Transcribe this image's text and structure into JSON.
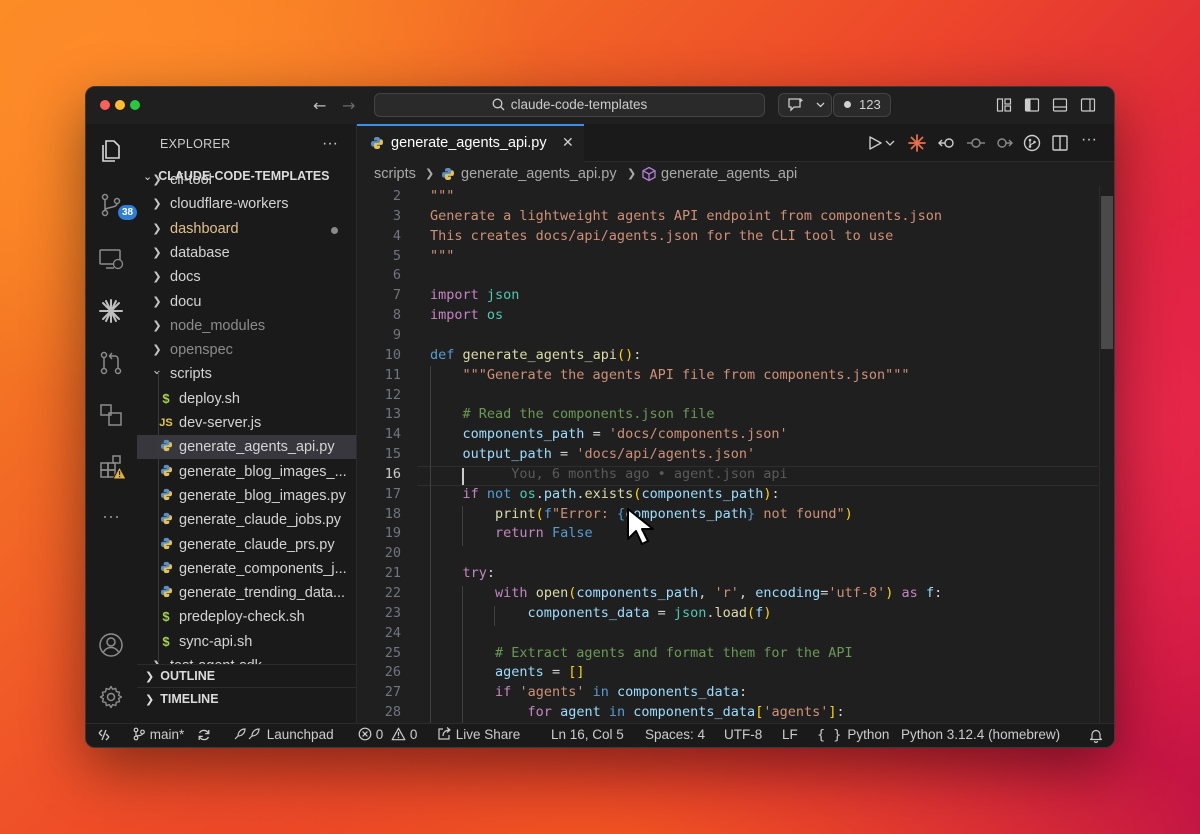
{
  "titlebar": {
    "search_text": "claude-code-templates",
    "count": "123"
  },
  "activity": {
    "scm_badge": "38"
  },
  "sidebar": {
    "header": "EXPLORER",
    "more": "···",
    "root": "CLAUDE-CODE-TEMPLATES",
    "items": [
      {
        "label": "cli-tool",
        "type": "folder"
      },
      {
        "label": "cloudflare-workers",
        "type": "folder"
      },
      {
        "label": "dashboard",
        "type": "folder"
      },
      {
        "label": "database",
        "type": "folder"
      },
      {
        "label": "docs",
        "type": "folder"
      },
      {
        "label": "docu",
        "type": "folder"
      },
      {
        "label": "node_modules",
        "type": "folder"
      },
      {
        "label": "openspec",
        "type": "folder"
      },
      {
        "label": "scripts",
        "type": "folder-open"
      },
      {
        "label": "deploy.sh",
        "type": "sh"
      },
      {
        "label": "dev-server.js",
        "type": "js"
      },
      {
        "label": "generate_agents_api.py",
        "type": "py"
      },
      {
        "label": "generate_blog_images_...",
        "type": "py"
      },
      {
        "label": "generate_blog_images.py",
        "type": "py"
      },
      {
        "label": "generate_claude_jobs.py",
        "type": "py"
      },
      {
        "label": "generate_claude_prs.py",
        "type": "py"
      },
      {
        "label": "generate_components_j...",
        "type": "py"
      },
      {
        "label": "generate_trending_data...",
        "type": "py"
      },
      {
        "label": "predeploy-check.sh",
        "type": "sh"
      },
      {
        "label": "sync-api.sh",
        "type": "sh"
      },
      {
        "label": "test-agent-sdk",
        "type": "folder"
      }
    ],
    "outline": "OUTLINE",
    "timeline": "TIMELINE"
  },
  "editor": {
    "tab_label": "generate_agents_api.py",
    "breadcrumb": [
      "scripts",
      "generate_agents_api.py",
      "generate_agents_api"
    ],
    "lines": [
      {
        "n": "2",
        "html": "<span class=\"tok-str\">\"\"\"</span>"
      },
      {
        "n": "3",
        "html": "<span class=\"tok-str\">Generate a lightweight agents API endpoint from components.json</span>"
      },
      {
        "n": "4",
        "html": "<span class=\"tok-str\">This creates docs/api/agents.json for the CLI tool to use</span>"
      },
      {
        "n": "5",
        "html": "<span class=\"tok-str\">\"\"\"</span>"
      },
      {
        "n": "6",
        "html": ""
      },
      {
        "n": "7",
        "html": "<span class=\"tok-ctl\">import</span> <span class=\"tok-bi\">json</span>"
      },
      {
        "n": "8",
        "html": "<span class=\"tok-ctl\">import</span> <span class=\"tok-bi\">os</span>"
      },
      {
        "n": "9",
        "html": ""
      },
      {
        "n": "10",
        "html": "<span class=\"tok-kw\">def</span> <span class=\"tok-fn\">generate_agents_api</span><span class=\"tok-br1\">()</span>:"
      },
      {
        "n": "11",
        "html": "    <span class=\"tok-str\">\"\"\"Generate the agents API file from components.json\"\"\"</span>"
      },
      {
        "n": "12",
        "html": ""
      },
      {
        "n": "13",
        "html": "    <span class=\"tok-cm\"># Read the components.json file</span>"
      },
      {
        "n": "14",
        "html": "    <span class=\"tok-var\">components_path</span> = <span class=\"tok-str\">'docs/components.json'</span>"
      },
      {
        "n": "15",
        "html": "    <span class=\"tok-var\">output_path</span> = <span class=\"tok-str\">'docs/api/agents.json'</span>"
      },
      {
        "n": "16",
        "html": "          <span class=\"ghost\">You, 6 months ago • agent.json api</span>"
      },
      {
        "n": "17",
        "html": "    <span class=\"tok-ctl\">if</span> <span class=\"tok-kw\">not</span> <span class=\"tok-bi\">os</span>.<span class=\"tok-var\">path</span>.<span class=\"tok-fn\">exists</span><span class=\"tok-br1\">(</span><span class=\"tok-var\">components_path</span><span class=\"tok-br1\">)</span>:"
      },
      {
        "n": "18",
        "html": "        <span class=\"tok-fn\">print</span><span class=\"tok-br1\">(</span><span class=\"tok-kw\">f</span><span class=\"tok-str\">\"Error: </span><span class=\"tok-kw\">{</span><span class=\"tok-var\">components_path</span><span class=\"tok-kw\">}</span><span class=\"tok-str\"> not found\"</span><span class=\"tok-br1\">)</span>"
      },
      {
        "n": "19",
        "html": "        <span class=\"tok-ctl\">return</span> <span class=\"tok-kw\">False</span>"
      },
      {
        "n": "20",
        "html": ""
      },
      {
        "n": "21",
        "html": "    <span class=\"tok-ctl\">try</span>:"
      },
      {
        "n": "22",
        "html": "        <span class=\"tok-ctl\">with</span> <span class=\"tok-fn\">open</span><span class=\"tok-br1\">(</span><span class=\"tok-var\">components_path</span>, <span class=\"tok-str\">'r'</span>, <span class=\"tok-var\">encoding</span>=<span class=\"tok-str\">'utf-8'</span><span class=\"tok-br1\">)</span> <span class=\"tok-ctl\">as</span> <span class=\"tok-var\">f</span>:"
      },
      {
        "n": "23",
        "html": "            <span class=\"tok-var\">components_data</span> = <span class=\"tok-bi\">json</span>.<span class=\"tok-fn\">load</span><span class=\"tok-br1\">(</span><span class=\"tok-var\">f</span><span class=\"tok-br1\">)</span>"
      },
      {
        "n": "24",
        "html": ""
      },
      {
        "n": "25",
        "html": "        <span class=\"tok-cm\"># Extract agents and format them for the API</span>"
      },
      {
        "n": "26",
        "html": "        <span class=\"tok-var\">agents</span> = <span class=\"tok-br1\">[]</span>"
      },
      {
        "n": "27",
        "html": "        <span class=\"tok-ctl\">if</span> <span class=\"tok-str\">'agents'</span> <span class=\"tok-kw\">in</span> <span class=\"tok-var\">components_data</span>:"
      },
      {
        "n": "28",
        "html": "            <span class=\"tok-ctl\">for</span> <span class=\"tok-var\">agent</span> <span class=\"tok-kw\">in</span> <span class=\"tok-var\">components_data</span><span class=\"tok-br1\">[</span><span class=\"tok-str\">'agents'</span><span class=\"tok-br1\">]</span>:"
      }
    ]
  },
  "statusbar": {
    "branch": "main*",
    "launchpad": "Launchpad",
    "errors": "0",
    "warnings": "0",
    "live_share": "Live Share",
    "position": "Ln 16, Col 5",
    "spaces": "Spaces: 4",
    "encoding": "UTF-8",
    "eol": "LF",
    "language": "Python",
    "interpreter": "Python 3.12.4 (homebrew)"
  },
  "colors": {
    "accent": "#3b8eea",
    "badge": "#2f7fd8",
    "background": "#1f1f1f"
  }
}
